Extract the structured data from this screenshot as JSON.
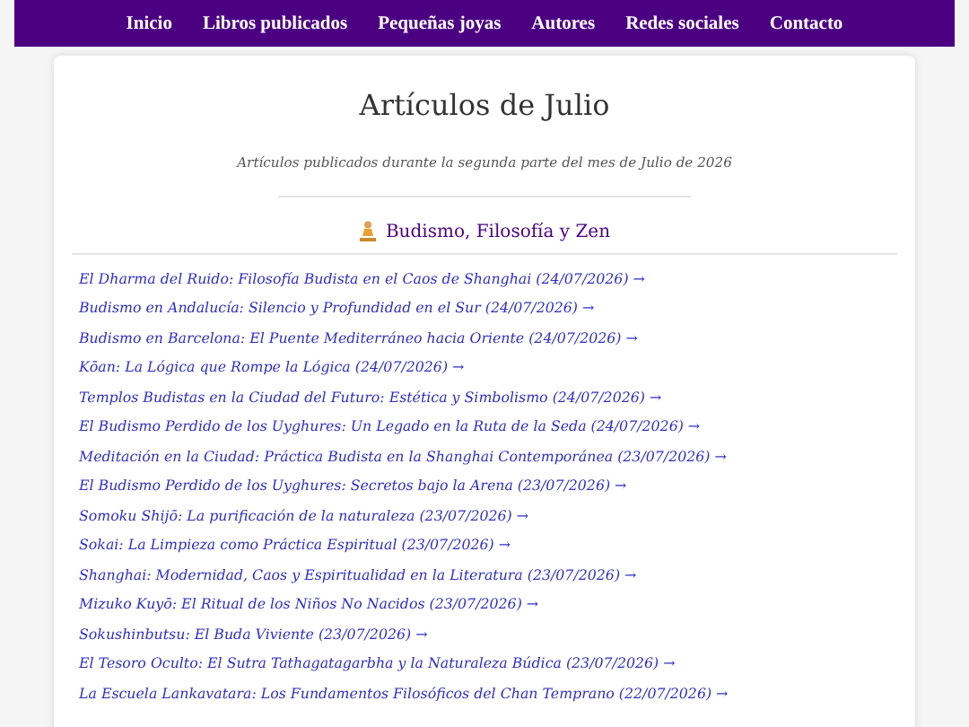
{
  "nav": [
    {
      "label": "Inicio"
    },
    {
      "label": "Libros publicados"
    },
    {
      "label": "Pequeñas joyas"
    },
    {
      "label": "Autores"
    },
    {
      "label": "Redes sociales"
    },
    {
      "label": "Contacto"
    }
  ],
  "title": "Artículos de Julio",
  "subtitle": "Artículos publicados durante la segunda parte del mes de Julio de 2026",
  "section": {
    "heading": "Budismo, Filosofía y Zen",
    "articles": [
      {
        "label": "El Dharma del Ruido: Filosofía Budista en el Caos de Shanghai (24/07/2026) →"
      },
      {
        "label": "Budismo en Andalucía: Silencio y Profundidad en el Sur (24/07/2026) →"
      },
      {
        "label": "Budismo en Barcelona: El Puente Mediterráneo hacia Oriente (24/07/2026) →"
      },
      {
        "label": "Kōan: La Lógica que Rompe la Lógica (24/07/2026) →"
      },
      {
        "label": "Templos Budistas en la Ciudad del Futuro: Estética y Simbolismo (24/07/2026) →"
      },
      {
        "label": "El Budismo Perdido de los Uyghures: Un Legado en la Ruta de la Seda (24/07/2026) →"
      },
      {
        "label": "Meditación en la Ciudad: Práctica Budista en la Shanghai Contemporánea (23/07/2026) →"
      },
      {
        "label": "El Budismo Perdido de los Uyghures: Secretos bajo la Arena (23/07/2026) →"
      },
      {
        "label": "Somoku Shijō: La purificación de la naturaleza (23/07/2026) →"
      },
      {
        "label": "Sokai: La Limpieza como Práctica Espiritual (23/07/2026) →"
      },
      {
        "label": "Shanghai: Modernidad, Caos y Espiritualidad en la Literatura (23/07/2026) →"
      },
      {
        "label": "Mizuko Kuyō: El Ritual de los Niños No Nacidos (23/07/2026) →"
      },
      {
        "label": "Sokushinbutsu: El Buda Viviente (23/07/2026) →"
      },
      {
        "label": "El Tesoro Oculto: El Sutra Tathagatagarbha y la Naturaleza Búdica (23/07/2026) →"
      },
      {
        "label": "La Escuela Lankavatara: Los Fundamentos Filosóficos del Chan Temprano (22/07/2026) →"
      }
    ]
  }
}
